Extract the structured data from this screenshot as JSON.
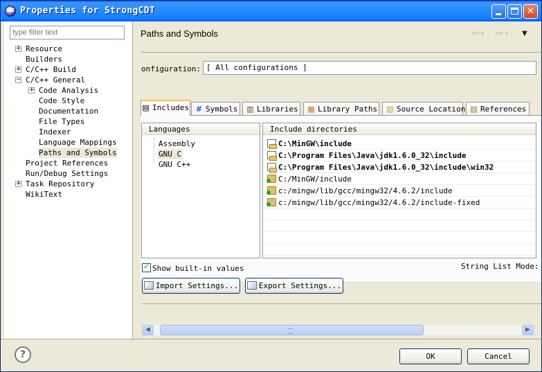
{
  "window": {
    "title": "Properties for StrongCDT",
    "controls": {
      "minimize": "minimize",
      "maximize": "maximize",
      "close": "✕"
    }
  },
  "filter": {
    "placeholder": "type filter text"
  },
  "tree": [
    {
      "label": "Resource",
      "expander": "+"
    },
    {
      "label": "Builders",
      "expander": ""
    },
    {
      "label": "C/C++ Build",
      "expander": "+"
    },
    {
      "label": "C/C++ General",
      "expander": "−"
    },
    {
      "label": "Code Analysis",
      "expander": "+"
    },
    {
      "label": "Code Style",
      "expander": ""
    },
    {
      "label": "Documentation",
      "expander": ""
    },
    {
      "label": "File Types",
      "expander": ""
    },
    {
      "label": "Indexer",
      "expander": ""
    },
    {
      "label": "Language Mappings",
      "expander": ""
    },
    {
      "label": "Paths and Symbols",
      "expander": "",
      "selected": true
    },
    {
      "label": "Project References",
      "expander": ""
    },
    {
      "label": "Run/Debug Settings",
      "expander": ""
    },
    {
      "label": "Task Repository",
      "expander": "+"
    },
    {
      "label": "WikiText",
      "expander": ""
    }
  ],
  "header": {
    "title": "Paths and Symbols",
    "back_icon": "⇦",
    "forward_icon": "⇨",
    "menu_icon": "▼",
    "small_dropdown": "▾"
  },
  "configuration": {
    "label": "onfiguration:",
    "value": "[ All configurations ]"
  },
  "tabs": [
    {
      "label": "Includes",
      "icon": "include-icon",
      "glyph": "▤",
      "active": true
    },
    {
      "label": "Symbols",
      "icon": "hash-icon",
      "glyph": "#"
    },
    {
      "label": "Libraries",
      "icon": "library-icon",
      "glyph": "▥"
    },
    {
      "label": "Library Paths",
      "icon": "library-path-icon",
      "glyph": "▦"
    },
    {
      "label": "Source Location",
      "icon": "folder-icon",
      "glyph": "▧"
    },
    {
      "label": "References",
      "icon": "references-icon",
      "glyph": "▨"
    }
  ],
  "languages": {
    "header": "Languages",
    "items": [
      "Assembly",
      "GNU C",
      "GNU C++"
    ],
    "selected": "GNU C"
  },
  "include_dirs": {
    "header": "Include directories",
    "rows": [
      {
        "path": "C:\\MinGW\\include",
        "bold": true,
        "icon": "workspace-page-icon"
      },
      {
        "path": "C:\\Program Files\\Java\\jdk1.6.0_32\\include",
        "bold": true,
        "icon": "workspace-page-icon"
      },
      {
        "path": "C:\\Program Files\\Java\\jdk1.6.0_32\\include\\win32",
        "bold": true,
        "icon": "workspace-page-icon"
      },
      {
        "path": "C:/MinGW/include",
        "bold": false,
        "icon": "builtin-folder-icon"
      },
      {
        "path": "c:/mingw/lib/gcc/mingw32/4.6.2/include",
        "bold": false,
        "icon": "builtin-folder-icon"
      },
      {
        "path": "c:/mingw/lib/gcc/mingw32/4.6.2/include-fixed",
        "bold": false,
        "icon": "builtin-folder-icon"
      }
    ]
  },
  "show_builtin": {
    "label": "Show built-in values",
    "checked": true
  },
  "string_list_mode": {
    "label": "String List Mode:"
  },
  "buttons": {
    "import": "Import Settings...",
    "export": "Export Settings...",
    "ok": "OK",
    "cancel": "Cancel"
  },
  "scrollbar": {
    "left": "◀",
    "right": "▶"
  },
  "help": {
    "glyph": "?"
  }
}
